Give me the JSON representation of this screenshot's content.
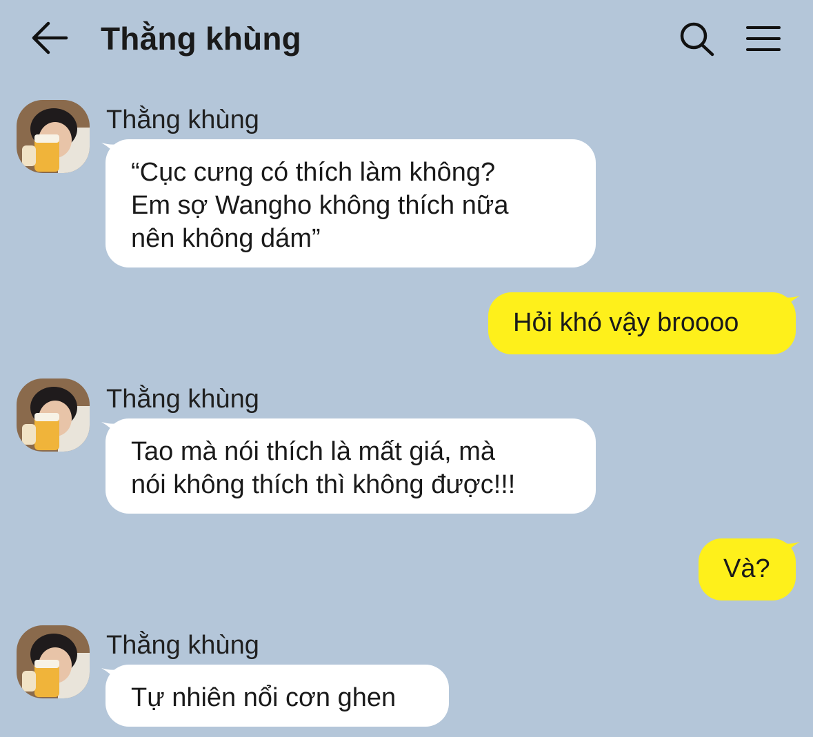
{
  "header": {
    "title": "Thằng khùng",
    "back_icon": "arrow-left-icon",
    "search_icon": "search-icon",
    "menu_icon": "hamburger-menu-icon"
  },
  "colors": {
    "background": "#b4c6d9",
    "incoming_bubble": "#ffffff",
    "outgoing_bubble": "#fef01b",
    "text": "#1a1a1a"
  },
  "messages": [
    {
      "direction": "incoming",
      "sender": "Thằng khùng",
      "lines": [
        "“Cục cưng có thích làm không?",
        "Em sợ Wangho không thích nữa",
        "nên không dám”"
      ]
    },
    {
      "direction": "outgoing",
      "lines": [
        "Hỏi khó vậy broooo"
      ]
    },
    {
      "direction": "incoming",
      "sender": "Thằng khùng",
      "lines": [
        "Tao mà nói thích là mất giá, mà",
        "nói không thích thì không được!!!"
      ]
    },
    {
      "direction": "outgoing",
      "lines": [
        "Và?"
      ]
    },
    {
      "direction": "incoming",
      "sender": "Thằng khùng",
      "lines": [
        "Tự nhiên nổi cơn ghen"
      ]
    }
  ]
}
